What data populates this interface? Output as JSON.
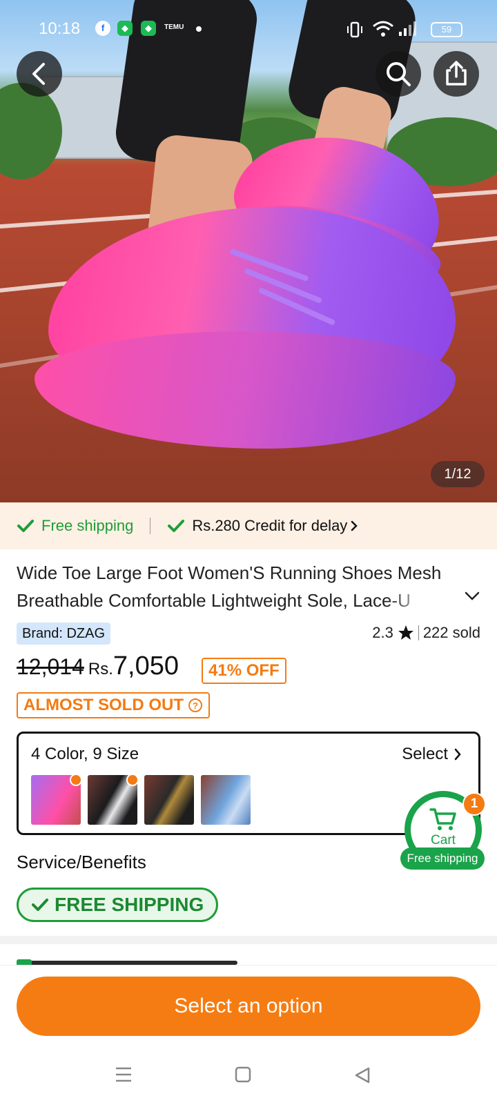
{
  "status_bar": {
    "time": "10:18",
    "battery": "59",
    "temu_label": "TEMU"
  },
  "gallery": {
    "counter": "1/12"
  },
  "shipping_strip": {
    "free_shipping": "Free shipping",
    "credit": "Rs.280 Credit for delay"
  },
  "product": {
    "title": "Wide Toe Large Foot Women'S Running Shoes Mesh Breathable Comfortable Lightweight Sole, Lace-U",
    "brand": "Brand: DZAG",
    "rating": "2.3",
    "sold": "222 sold",
    "old_price": "12,014",
    "currency": "Rs.",
    "price": "7,050",
    "discount": "41% OFF",
    "stock_label": "ALMOST SOLD OUT"
  },
  "variants": {
    "label": "4 Color, 9 Size",
    "select": "Select",
    "thumbnails": [
      {
        "color": "purple-pink",
        "hot": true
      },
      {
        "color": "black",
        "hot": true
      },
      {
        "color": "black-gold",
        "hot": false
      },
      {
        "color": "light-blue",
        "hot": false
      }
    ]
  },
  "cart": {
    "label": "Cart",
    "count": "1",
    "badge": "Free shipping"
  },
  "services": {
    "title": "Service/Benefits",
    "free_shipping": "FREE SHIPPING"
  },
  "cta": {
    "label": "Select an option"
  },
  "colors": {
    "accent": "#f57c12",
    "green": "#1aa34a"
  }
}
